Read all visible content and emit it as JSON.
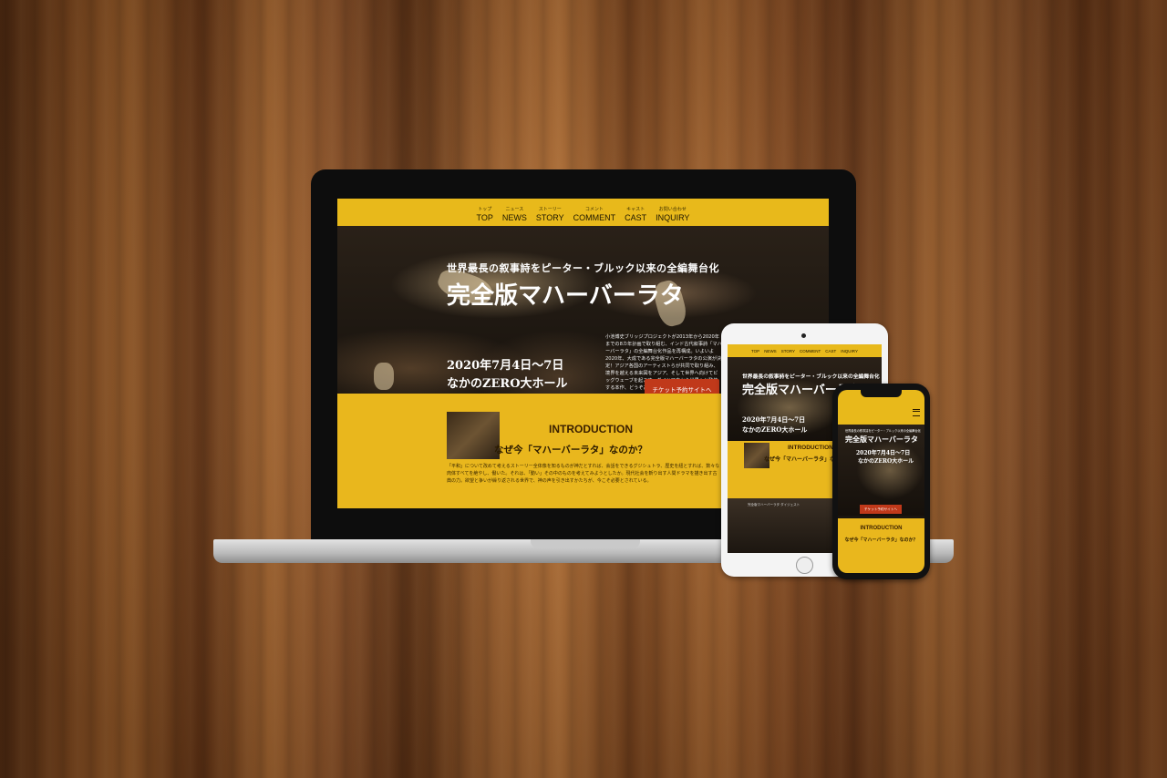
{
  "site": {
    "nav": [
      {
        "kana": "トップ",
        "label": "TOP"
      },
      {
        "kana": "ニュース",
        "label": "NEWS"
      },
      {
        "kana": "ストーリー",
        "label": "STORY"
      },
      {
        "kana": "コメント",
        "label": "COMMENT"
      },
      {
        "kana": "キャスト",
        "label": "CAST"
      },
      {
        "kana": "お問い合わせ",
        "label": "INQUIRY"
      }
    ],
    "hero": {
      "subtitle": "世界最長の叙事詩をピーター・ブルック以来の全編舞台化",
      "title": "完全版マハーバーラタ",
      "date": "2020年7月4日〜7日",
      "venue": "なかのZERO大ホール",
      "body": "小池博史ブリッジプロジェクトが2013年から2020年までの8カ年計画で取り組む、インド古代叙事詩「マハーバーラタ」の全編舞台化作品を再構成。いよいよ2020年、大成である完全版マハーバーラタの公演が決定！アジア各国のアーティストらが共同で取り組み、境界を越える未来図をアジア、そして世界へ向けてビッグウェーブを起こす。ダイと日本から世界へと発信する本作、どうぞお見逃しなく！",
      "ticket_button": "チケット予約サイトへ"
    },
    "intro": {
      "heading": "INTRODUCTION",
      "question": "なぜ今「マハーバーラタ」なのか？",
      "text": "「平和」について改めて考えるストーリー全体像を知るものが神だとすれば、会話をできるグジシュトラ、歴史を紐とすれば、数々な肉体すべてを絶やし、働いた。それは、「動い」その中のものを考えてみようとしたか。現代社会を斬り出す人間ドラマを描き出す古典の力。欲望と争いが繰り返される世界で、神の声を引き出すかたちが、今こそ必要とされている。"
    },
    "video_caption": "完全版マハーバーラタ ダイジェスト"
  }
}
